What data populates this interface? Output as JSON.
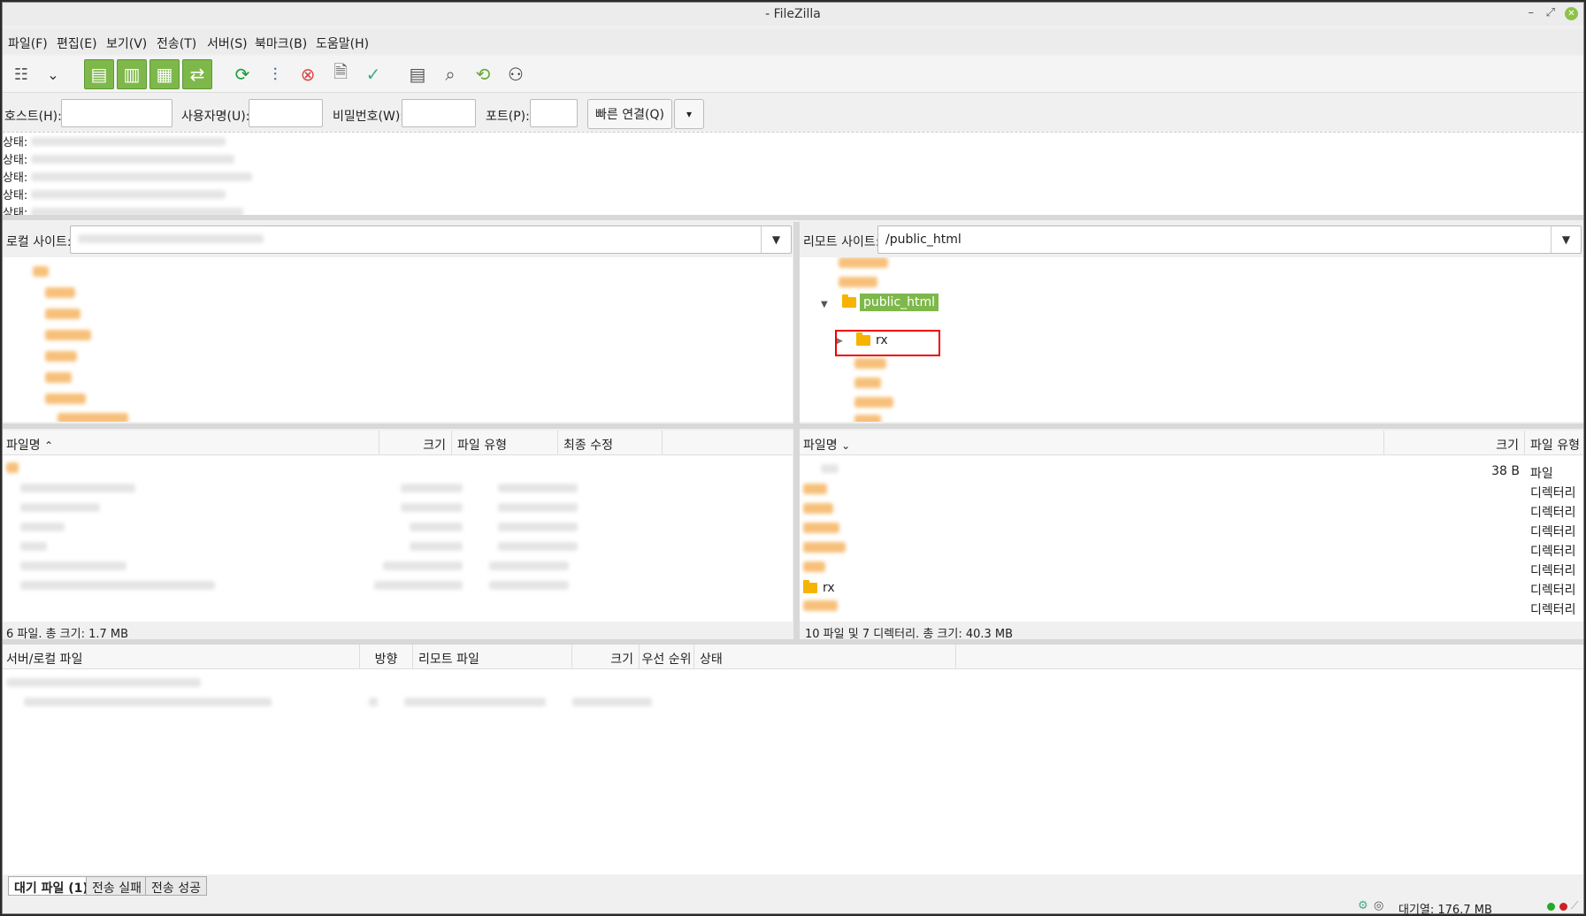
{
  "window": {
    "title": "- FileZilla"
  },
  "menu": [
    "파일(F)",
    "편집(E)",
    "보기(V)",
    "전송(T)",
    "서버(S)",
    "북마크(B)",
    "도움말(H)"
  ],
  "toolbar": {
    "icons": [
      "site-manager-icon",
      "dropdown-icon",
      "toggle-log-icon",
      "toggle-local-tree-icon",
      "toggle-remote-tree-icon",
      "toggle-queue-icon",
      "refresh-icon",
      "filter-icon",
      "cancel-icon",
      "disconnect-icon",
      "reconnect-icon",
      "compare-icon",
      "sync-browse-icon",
      "search-icon",
      "find-icon"
    ]
  },
  "quickconnect": {
    "host_label": "호스트(H):",
    "user_label": "사용자명(U):",
    "pass_label": "비밀번호(W):",
    "port_label": "포트(P):",
    "connect_label": "빠른 연결(Q)"
  },
  "log": {
    "prefix": "상태:"
  },
  "local": {
    "site_label": "로컬 사이트:",
    "columns": [
      "파일명",
      "크기",
      "파일 유형",
      "최종 수정"
    ],
    "status": "6 파일. 총 크기: 1.7 MB"
  },
  "remote": {
    "site_label": "리모트 사이트:",
    "path": "/public_html",
    "tree_selected": "public_html",
    "tree_child": "rx",
    "columns": [
      "파일명",
      "크기",
      "파일 유형"
    ],
    "rows": [
      {
        "name": "",
        "size": "38 B",
        "type": "파일"
      },
      {
        "name": "",
        "size": "",
        "type": "디렉터리"
      },
      {
        "name": "",
        "size": "",
        "type": "디렉터리"
      },
      {
        "name": "",
        "size": "",
        "type": "디렉터리"
      },
      {
        "name": "",
        "size": "",
        "type": "디렉터리"
      },
      {
        "name": "",
        "size": "",
        "type": "디렉터리"
      },
      {
        "name": "rx",
        "size": "",
        "type": "디렉터리"
      },
      {
        "name": "",
        "size": "",
        "type": "디렉터리"
      }
    ],
    "status": "10 파일 및 7 디렉터리. 총 크기: 40.3 MB"
  },
  "queue": {
    "columns": [
      "서버/로컬 파일",
      "방향",
      "리모트 파일",
      "크기",
      "우선 순위",
      "상태"
    ],
    "tabs": [
      "대기 파일 (1)",
      "전송 실패",
      "전송 성공"
    ]
  },
  "statusbar": {
    "queue": "대기열: 176.7 MB"
  }
}
